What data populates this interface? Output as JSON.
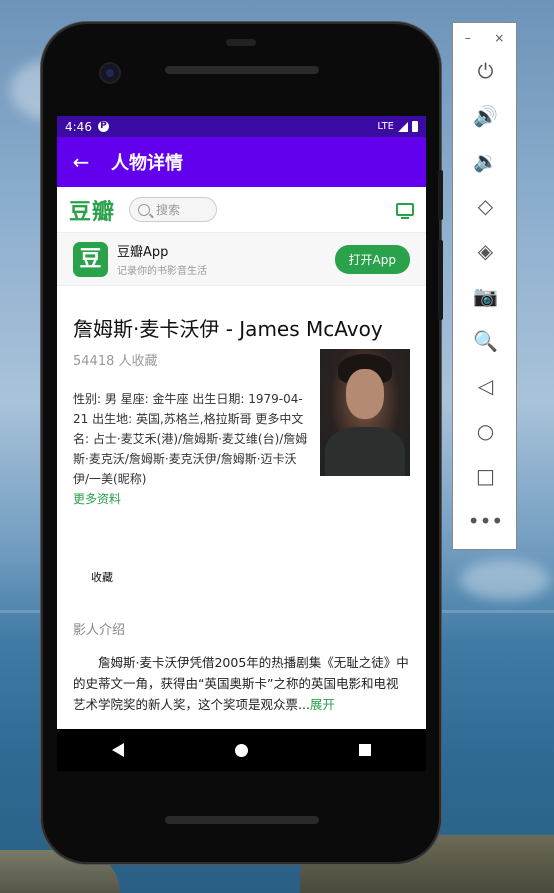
{
  "status_bar": {
    "time": "4:46",
    "network": "LTE"
  },
  "app_bar": {
    "title": "人物详情"
  },
  "douban": {
    "logo": "豆瓣",
    "search_placeholder": "搜索"
  },
  "promo": {
    "icon_char": "豆",
    "title": "豆瓣App",
    "subtitle": "记录你的书影音生活",
    "button": "打开App"
  },
  "person": {
    "title": "詹姆斯·麦卡沃伊 - James McAvoy",
    "fav_count": "54418 人收藏",
    "info": "性别: 男 星座: 金牛座 出生日期: 1979-04-21 出生地: 英国,苏格兰,格拉斯哥 更多中文名: 占士·麦艾禾(港)/詹姆斯·麦艾维(台)/詹姆斯·麦克沃/詹姆斯·麦克沃伊/詹姆斯·迈卡沃伊/一美(昵称)",
    "more": "更多资料",
    "collect": "收藏"
  },
  "bio": {
    "section_title": "影人介绍",
    "text": "詹姆斯·麦卡沃伊凭借2005年的热播剧集《无耻之徒》中的史蒂文一角，获得由“英国奥斯卡”之称的英国电影和电视艺术学院奖的新人奖，这个奖项是观众票...",
    "expand": "展开"
  },
  "emulator": {
    "minimize": "–",
    "close": "×"
  }
}
